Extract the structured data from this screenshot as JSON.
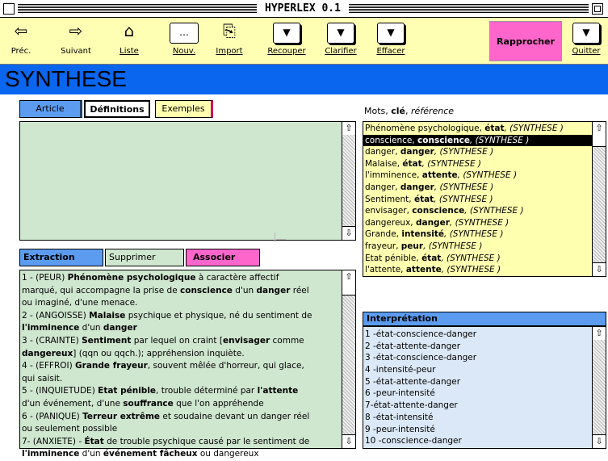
{
  "window": {
    "title": "HYPERLEX 0.1"
  },
  "toolbar": {
    "prev": {
      "label": "Préc.",
      "icon": "arrow-left-icon"
    },
    "next": {
      "label": "Suivant",
      "icon": "arrow-right-icon"
    },
    "list": {
      "label": "Liste",
      "icon": "house-icon"
    },
    "new": {
      "label": "Nouv.",
      "icon": "new-document-icon"
    },
    "import": {
      "label": "Import",
      "icon": "import-icon"
    },
    "recouper": {
      "label": "Recouper"
    },
    "clarifier": {
      "label": "Clarifier"
    },
    "effacer": {
      "label": "Effacer"
    },
    "rapprocher": {
      "label": "Rapprocher",
      "color": "#ff66cc"
    },
    "quit": {
      "label": "Quitter"
    }
  },
  "banner": {
    "title": "SYNTHESE",
    "color": "#0a66ee"
  },
  "tabs": [
    {
      "label": "Article"
    },
    {
      "label": "Définitions"
    },
    {
      "label": "Exemples"
    }
  ],
  "keywords": {
    "header_mots": "Mots",
    "header_cle": "clé",
    "header_ref": "référence",
    "items": [
      {
        "a": "Phénomène psychologique, ",
        "b": "état",
        "c": ", (SYNTHESE )"
      },
      {
        "a": "conscience, ",
        "b": "conscience",
        "c": ", (SYNTHESE )"
      },
      {
        "a": "danger, ",
        "b": "danger",
        "c": ", (SYNTHESE )"
      },
      {
        "a": "Malaise, ",
        "b": "état",
        "c": ", (SYNTHESE )"
      },
      {
        "a": "l'imminence, ",
        "b": "attente",
        "c": ", (SYNTHESE )"
      },
      {
        "a": "danger, ",
        "b": "danger",
        "c": ", (SYNTHESE )"
      },
      {
        "a": "Sentiment, ",
        "b": "état",
        "c": ", (SYNTHESE )"
      },
      {
        "a": "envisager, ",
        "b": "conscience",
        "c": ", (SYNTHESE )"
      },
      {
        "a": "dangereux, ",
        "b": "danger",
        "c": ", (SYNTHESE )"
      },
      {
        "a": "Grande, ",
        "b": "intensité",
        "c": ", (SYNTHESE )"
      },
      {
        "a": "frayeur, ",
        "b": "peur",
        "c": ", (SYNTHESE )"
      },
      {
        "a": "Etat pénible, ",
        "b": "état",
        "c": ", (SYNTHESE )"
      },
      {
        "a": "l'attente, ",
        "b": "attente",
        "c": ", (SYNTHESE )"
      }
    ],
    "selected_index": 1
  },
  "actions": {
    "extraction": "Extraction",
    "supprimer": "Supprimer",
    "associer": "Associer"
  },
  "definitions": [
    [
      {
        "t": "1 - (PEUR)  "
      },
      {
        "t": "Phénomène psychologique",
        "b": true
      },
      {
        "t": " à caractère affectif"
      }
    ],
    [
      {
        "t": "marqué, qui accompagne la prise de "
      },
      {
        "t": "conscience",
        "b": true
      },
      {
        "t": " d'un "
      },
      {
        "t": "danger",
        "b": true
      },
      {
        "t": " réel"
      }
    ],
    [
      {
        "t": "ou imaginé, d'une menace."
      }
    ],
    [
      {
        "t": "2 - (ANGOISSE)  "
      },
      {
        "t": "Malaise",
        "b": true
      },
      {
        "t": " psychique et physique, né du sentiment de"
      }
    ],
    [
      {
        "t": "l'imminence",
        "b": true
      },
      {
        "t": " d'un "
      },
      {
        "t": "danger",
        "b": true
      }
    ],
    [
      {
        "t": "3 - (CRAINTE) "
      },
      {
        "t": "Sentiment",
        "b": true
      },
      {
        "t": " par lequel on craint ["
      },
      {
        "t": "envisager",
        "b": true
      },
      {
        "t": " comme"
      }
    ],
    [
      {
        "t": "dangereux",
        "b": true
      },
      {
        "t": "] (qqn ou qqch.); appréhension inquiète."
      }
    ],
    [
      {
        "t": "4 - (EFFROI) "
      },
      {
        "t": "Grande frayeur",
        "b": true
      },
      {
        "t": ", souvent mêlée d'horreur, qui glace,"
      }
    ],
    [
      {
        "t": "qui saisit."
      }
    ],
    [
      {
        "t": "5 - (INQUIETUDE) "
      },
      {
        "t": "Etat pénible",
        "b": true
      },
      {
        "t": ", trouble déterminé par "
      },
      {
        "t": "l'attente",
        "b": true
      }
    ],
    [
      {
        "t": "d'un événement, d'une "
      },
      {
        "t": "souffrance",
        "b": true
      },
      {
        "t": " que l'on appréhende"
      }
    ],
    [
      {
        "t": "6 - (PANIQUE) "
      },
      {
        "t": "Terreur extrême",
        "b": true
      },
      {
        "t": " et soudaine devant un danger réel"
      }
    ],
    [
      {
        "t": "ou seulement possible"
      }
    ],
    [
      {
        "t": "7- (ANXIETE) - "
      },
      {
        "t": "État",
        "b": true
      },
      {
        "t": " de trouble psychique causé par le sentiment de"
      }
    ],
    [
      {
        "t": "l'imminence",
        "b": true
      },
      {
        "t": " d'un "
      },
      {
        "t": "événement fâcheux",
        "b": true
      },
      {
        "t": " ou dangereux"
      }
    ]
  ],
  "interpretation": {
    "title": "Interprétation",
    "items": [
      "1 -état-conscience-danger",
      "2 -état-attente-danger",
      "3 -état-conscience-danger",
      "4 -intensité-peur",
      "5 -état-attente-danger",
      "6 -peur-intensité",
      "7-état-attente-danger",
      "8 -état-intensité",
      "9 -peur-intensité",
      "10 -conscience-danger"
    ]
  }
}
